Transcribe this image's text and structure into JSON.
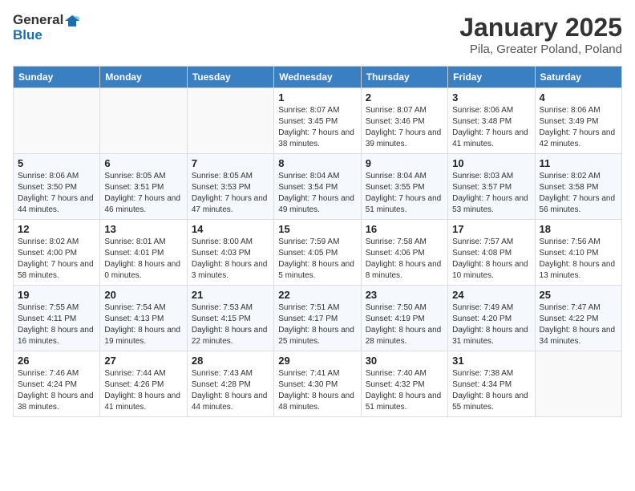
{
  "header": {
    "logo_general": "General",
    "logo_blue": "Blue",
    "month": "January 2025",
    "location": "Pila, Greater Poland, Poland"
  },
  "weekdays": [
    "Sunday",
    "Monday",
    "Tuesday",
    "Wednesday",
    "Thursday",
    "Friday",
    "Saturday"
  ],
  "weeks": [
    [
      {
        "day": "",
        "info": ""
      },
      {
        "day": "",
        "info": ""
      },
      {
        "day": "",
        "info": ""
      },
      {
        "day": "1",
        "info": "Sunrise: 8:07 AM\nSunset: 3:45 PM\nDaylight: 7 hours and 38 minutes."
      },
      {
        "day": "2",
        "info": "Sunrise: 8:07 AM\nSunset: 3:46 PM\nDaylight: 7 hours and 39 minutes."
      },
      {
        "day": "3",
        "info": "Sunrise: 8:06 AM\nSunset: 3:48 PM\nDaylight: 7 hours and 41 minutes."
      },
      {
        "day": "4",
        "info": "Sunrise: 8:06 AM\nSunset: 3:49 PM\nDaylight: 7 hours and 42 minutes."
      }
    ],
    [
      {
        "day": "5",
        "info": "Sunrise: 8:06 AM\nSunset: 3:50 PM\nDaylight: 7 hours and 44 minutes."
      },
      {
        "day": "6",
        "info": "Sunrise: 8:05 AM\nSunset: 3:51 PM\nDaylight: 7 hours and 46 minutes."
      },
      {
        "day": "7",
        "info": "Sunrise: 8:05 AM\nSunset: 3:53 PM\nDaylight: 7 hours and 47 minutes."
      },
      {
        "day": "8",
        "info": "Sunrise: 8:04 AM\nSunset: 3:54 PM\nDaylight: 7 hours and 49 minutes."
      },
      {
        "day": "9",
        "info": "Sunrise: 8:04 AM\nSunset: 3:55 PM\nDaylight: 7 hours and 51 minutes."
      },
      {
        "day": "10",
        "info": "Sunrise: 8:03 AM\nSunset: 3:57 PM\nDaylight: 7 hours and 53 minutes."
      },
      {
        "day": "11",
        "info": "Sunrise: 8:02 AM\nSunset: 3:58 PM\nDaylight: 7 hours and 56 minutes."
      }
    ],
    [
      {
        "day": "12",
        "info": "Sunrise: 8:02 AM\nSunset: 4:00 PM\nDaylight: 7 hours and 58 minutes."
      },
      {
        "day": "13",
        "info": "Sunrise: 8:01 AM\nSunset: 4:01 PM\nDaylight: 8 hours and 0 minutes."
      },
      {
        "day": "14",
        "info": "Sunrise: 8:00 AM\nSunset: 4:03 PM\nDaylight: 8 hours and 3 minutes."
      },
      {
        "day": "15",
        "info": "Sunrise: 7:59 AM\nSunset: 4:05 PM\nDaylight: 8 hours and 5 minutes."
      },
      {
        "day": "16",
        "info": "Sunrise: 7:58 AM\nSunset: 4:06 PM\nDaylight: 8 hours and 8 minutes."
      },
      {
        "day": "17",
        "info": "Sunrise: 7:57 AM\nSunset: 4:08 PM\nDaylight: 8 hours and 10 minutes."
      },
      {
        "day": "18",
        "info": "Sunrise: 7:56 AM\nSunset: 4:10 PM\nDaylight: 8 hours and 13 minutes."
      }
    ],
    [
      {
        "day": "19",
        "info": "Sunrise: 7:55 AM\nSunset: 4:11 PM\nDaylight: 8 hours and 16 minutes."
      },
      {
        "day": "20",
        "info": "Sunrise: 7:54 AM\nSunset: 4:13 PM\nDaylight: 8 hours and 19 minutes."
      },
      {
        "day": "21",
        "info": "Sunrise: 7:53 AM\nSunset: 4:15 PM\nDaylight: 8 hours and 22 minutes."
      },
      {
        "day": "22",
        "info": "Sunrise: 7:51 AM\nSunset: 4:17 PM\nDaylight: 8 hours and 25 minutes."
      },
      {
        "day": "23",
        "info": "Sunrise: 7:50 AM\nSunset: 4:19 PM\nDaylight: 8 hours and 28 minutes."
      },
      {
        "day": "24",
        "info": "Sunrise: 7:49 AM\nSunset: 4:20 PM\nDaylight: 8 hours and 31 minutes."
      },
      {
        "day": "25",
        "info": "Sunrise: 7:47 AM\nSunset: 4:22 PM\nDaylight: 8 hours and 34 minutes."
      }
    ],
    [
      {
        "day": "26",
        "info": "Sunrise: 7:46 AM\nSunset: 4:24 PM\nDaylight: 8 hours and 38 minutes."
      },
      {
        "day": "27",
        "info": "Sunrise: 7:44 AM\nSunset: 4:26 PM\nDaylight: 8 hours and 41 minutes."
      },
      {
        "day": "28",
        "info": "Sunrise: 7:43 AM\nSunset: 4:28 PM\nDaylight: 8 hours and 44 minutes."
      },
      {
        "day": "29",
        "info": "Sunrise: 7:41 AM\nSunset: 4:30 PM\nDaylight: 8 hours and 48 minutes."
      },
      {
        "day": "30",
        "info": "Sunrise: 7:40 AM\nSunset: 4:32 PM\nDaylight: 8 hours and 51 minutes."
      },
      {
        "day": "31",
        "info": "Sunrise: 7:38 AM\nSunset: 4:34 PM\nDaylight: 8 hours and 55 minutes."
      },
      {
        "day": "",
        "info": ""
      }
    ]
  ]
}
